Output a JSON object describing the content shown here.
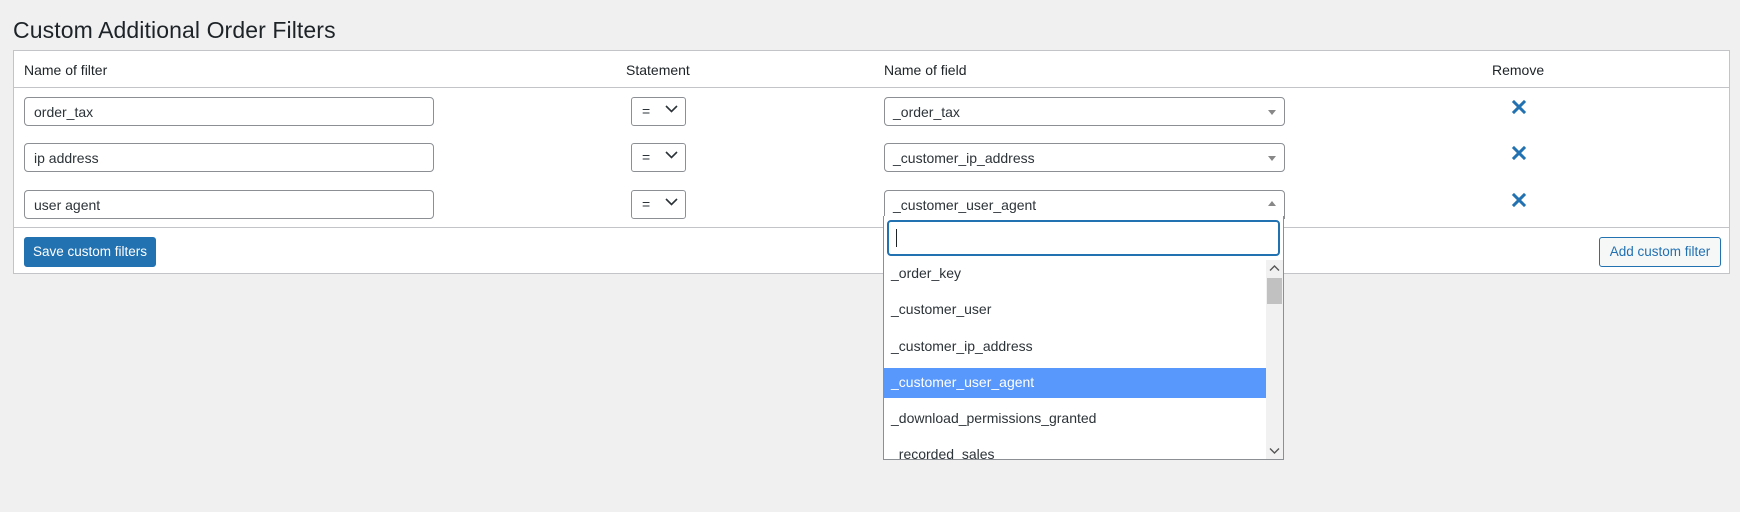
{
  "page": {
    "title": "Custom Additional Order Filters"
  },
  "table": {
    "headers": {
      "name_of_filter": "Name of filter",
      "statement": "Statement",
      "name_of_field": "Name of field",
      "remove": "Remove"
    },
    "rows": [
      {
        "filter_name": "order_tax",
        "statement": "=",
        "field": "_order_tax"
      },
      {
        "filter_name": "ip address",
        "statement": "=",
        "field": "_customer_ip_address"
      },
      {
        "filter_name": "user agent",
        "statement": "=",
        "field": "_customer_user_agent"
      }
    ]
  },
  "footer": {
    "save_label": "Save custom filters",
    "add_label": "Add custom filter"
  },
  "dropdown": {
    "search_value": "",
    "selected": "_customer_user_agent",
    "options": [
      "_order_key",
      "_customer_user",
      "_customer_ip_address",
      "_customer_user_agent",
      "_download_permissions_granted",
      "_recorded_sales"
    ]
  },
  "colors": {
    "primary": "#2271b1",
    "highlight": "#5897fb",
    "remove_icon": "#2271b1"
  },
  "icons": {
    "remove": "close-x-icon",
    "select_arrow": "chevron-down-icon",
    "scroll_up": "chevron-up-icon",
    "scroll_down": "chevron-down-icon"
  }
}
